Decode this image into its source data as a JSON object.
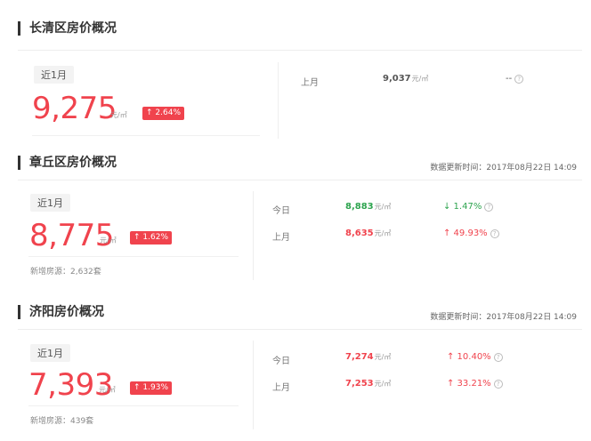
{
  "sections": [
    {
      "title": "长清区房价概况",
      "period": "近1月",
      "price": "9,275",
      "unit": "元/㎡",
      "change": "↑ 2.64%",
      "rows": [
        {
          "label": "上月",
          "value": "9,037",
          "unit": "元/㎡",
          "change": "--"
        }
      ]
    },
    {
      "title": "章丘区房价概况",
      "update_time": "数据更新时间：2017年08月22日 14:09",
      "period": "近1月",
      "price": "8,775",
      "unit": "元/㎡",
      "change": "↑ 1.62%",
      "new_listings": "新增房源：2,632套",
      "rows": [
        {
          "label": "今日",
          "value": "8,883",
          "unit": "元/㎡",
          "change": "↓ 1.47%",
          "value_color": "#2ea44f",
          "change_color": "#2ea44f"
        },
        {
          "label": "上月",
          "value": "8,635",
          "unit": "元/㎡",
          "change": "↑ 49.93%",
          "value_color": "#f0434d",
          "change_color": "#f0434d"
        }
      ]
    },
    {
      "title": "济阳房价概况",
      "update_time": "数据更新时间：2017年08月22日 14:09",
      "period": "近1月",
      "price": "7,393",
      "unit": "元/㎡",
      "change": "↑ 1.93%",
      "new_listings": "新增房源：439套",
      "rows": [
        {
          "label": "今日",
          "value": "7,274",
          "unit": "元/㎡",
          "change": "↑ 10.40%",
          "value_color": "#f0434d",
          "change_color": "#f0434d"
        },
        {
          "label": "上月",
          "value": "7,253",
          "unit": "元/㎡",
          "change": "↑ 33.21%",
          "value_color": "#f0434d",
          "change_color": "#f0434d"
        }
      ]
    }
  ],
  "help_icon": "question-circle-icon"
}
